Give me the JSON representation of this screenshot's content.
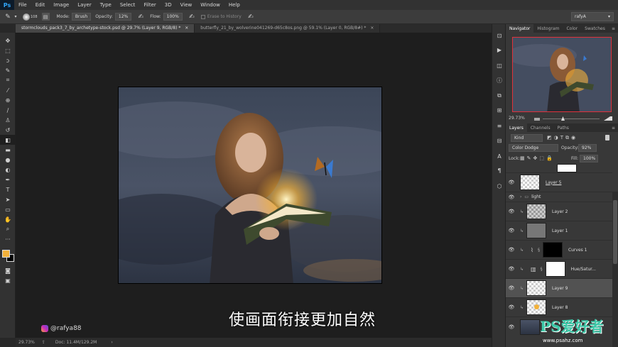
{
  "app": {
    "logo": "Ps",
    "menus": [
      "File",
      "Edit",
      "Image",
      "Layer",
      "Type",
      "Select",
      "Filter",
      "3D",
      "View",
      "Window",
      "Help"
    ]
  },
  "options": {
    "brush_size": "108",
    "mode_label": "Mode:",
    "mode_value": "Brush",
    "opacity_label": "Opacity:",
    "opacity_value": "12%",
    "flow_label": "Flow:",
    "flow_value": "100%",
    "erase_history": "Erase to History",
    "workspace": "rafyA"
  },
  "tabs": [
    {
      "label": "stormclouds_pack3_7_by_archetype-stock.psd @ 29.7% (Layer 9, RGB/8) *",
      "close": "×"
    },
    {
      "label": "butterfly_21_by_wolverine041269-d65c8os.png @ 59.1% (Layer 0, RGB/8#) *",
      "close": "×"
    }
  ],
  "navigator": {
    "tabs": [
      "Navigator",
      "Histogram",
      "Color",
      "Swatches"
    ],
    "zoom": "29.73%"
  },
  "layers": {
    "tabs": [
      "Layers",
      "Channels",
      "Paths"
    ],
    "filter_kind": "Kind",
    "blend_mode": "Color Dodge",
    "opacity_label": "Opacity:",
    "opacity_value": "92%",
    "lock_label": "Lock:",
    "fill_label": "Fill:",
    "fill_value": "100%",
    "items": [
      {
        "name": "Layer 5"
      },
      {
        "name": "light"
      },
      {
        "name": "Layer 2"
      },
      {
        "name": "Layer 1"
      },
      {
        "name": "Curves 1"
      },
      {
        "name": "Hue/Satur..."
      },
      {
        "name": "Layer 9"
      },
      {
        "name": "Layer 8"
      }
    ]
  },
  "status": {
    "zoom": "29.73%",
    "doc": "Doc: 11.4M/129.2M"
  },
  "subtitle": "使画面衔接更加自然",
  "watermark": {
    "handle": "@rafya88",
    "site_logo": "PS爱好者",
    "site_url": "www.psahz.com"
  },
  "colors": {
    "foreground": "#f2b13a",
    "background": "#000000",
    "nav_highlight": "#e0313b"
  }
}
